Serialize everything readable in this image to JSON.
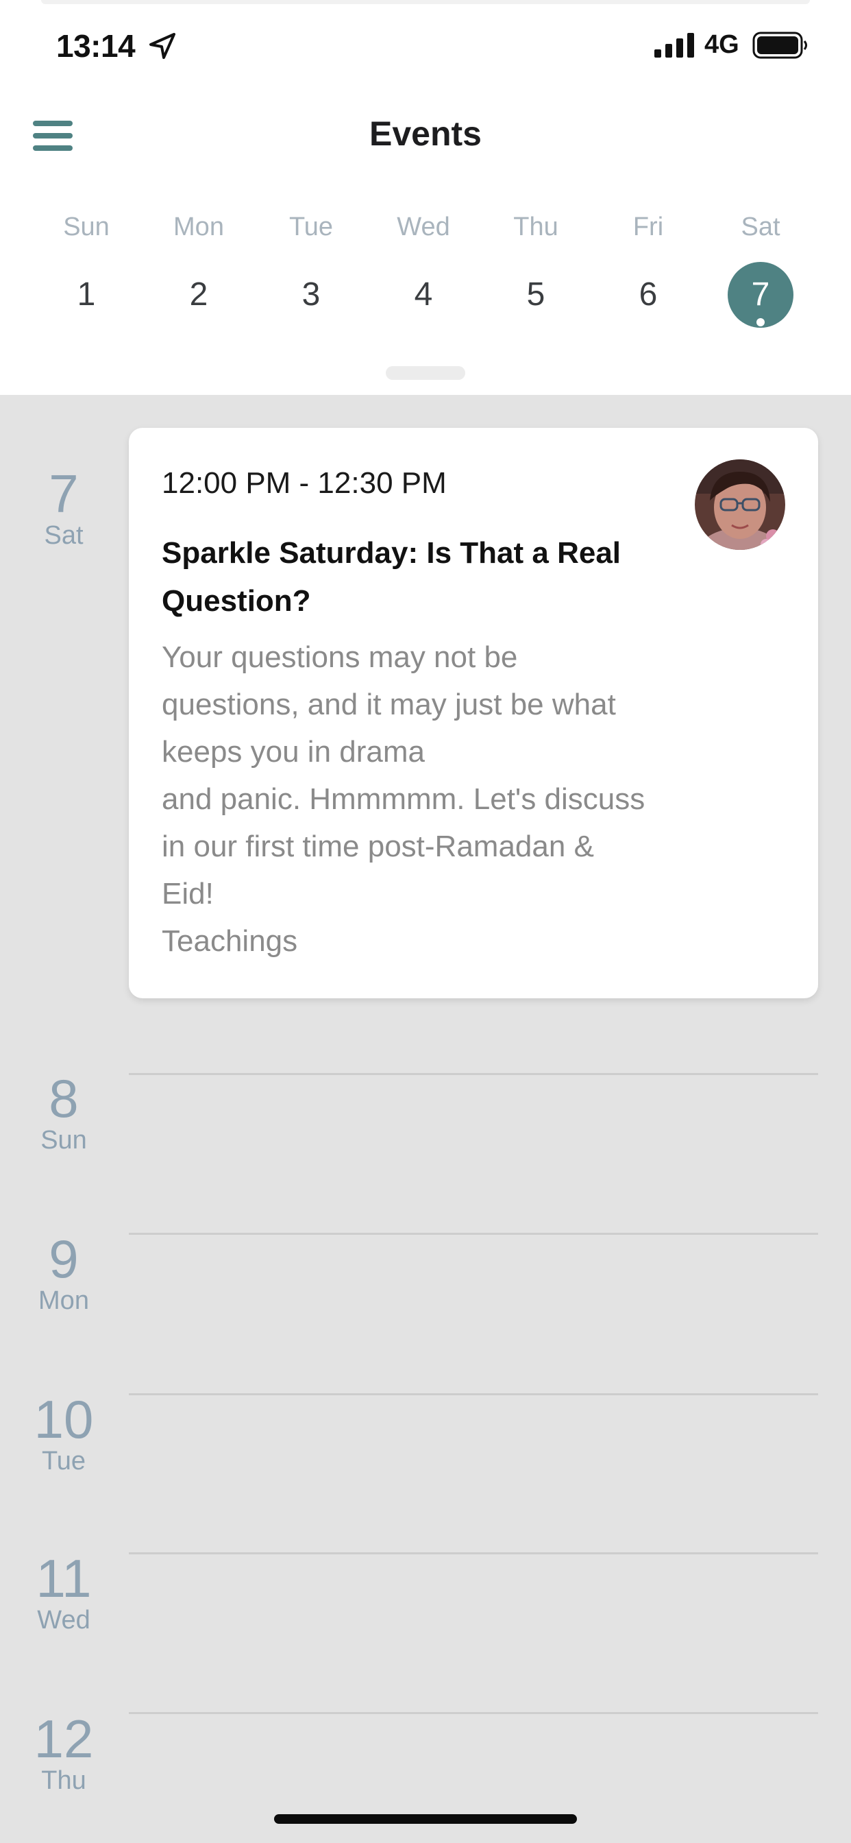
{
  "status_bar": {
    "time": "13:14",
    "network": "4G",
    "location_icon": "location-arrow-icon",
    "signal_icon": "cellular-signal-icon",
    "battery_icon": "battery-full-icon"
  },
  "header": {
    "title": "Events",
    "menu_icon": "hamburger-menu-icon"
  },
  "week": {
    "days": [
      {
        "name": "Sun",
        "num": "1"
      },
      {
        "name": "Mon",
        "num": "2"
      },
      {
        "name": "Tue",
        "num": "3"
      },
      {
        "name": "Wed",
        "num": "4"
      },
      {
        "name": "Thu",
        "num": "5"
      },
      {
        "name": "Fri",
        "num": "6"
      },
      {
        "name": "Sat",
        "num": "7"
      }
    ],
    "selected_index": 6
  },
  "agenda": {
    "days": [
      {
        "num": "7",
        "day": "Sat"
      },
      {
        "num": "8",
        "day": "Sun"
      },
      {
        "num": "9",
        "day": "Mon"
      },
      {
        "num": "10",
        "day": "Tue"
      },
      {
        "num": "11",
        "day": "Wed"
      },
      {
        "num": "12",
        "day": "Thu"
      }
    ],
    "event": {
      "time": "12:00 PM - 12:30 PM",
      "title_lines": [
        "Sparkle Saturday: Is That a Real",
        "Question?"
      ],
      "description_lines": [
        "Your questions may not be",
        "questions, and it may just be what",
        "keeps you in drama",
        "and panic. Hmmmmm. Let's discuss",
        "in our first time post-Ramadan &",
        "Eid!",
        "Teachings"
      ]
    }
  },
  "colors": {
    "accent": "#4f8283",
    "background": "#e3e3e3",
    "card": "#ffffff",
    "muted_text": "#8a8a8a",
    "date_text": "#8ea2b2"
  }
}
